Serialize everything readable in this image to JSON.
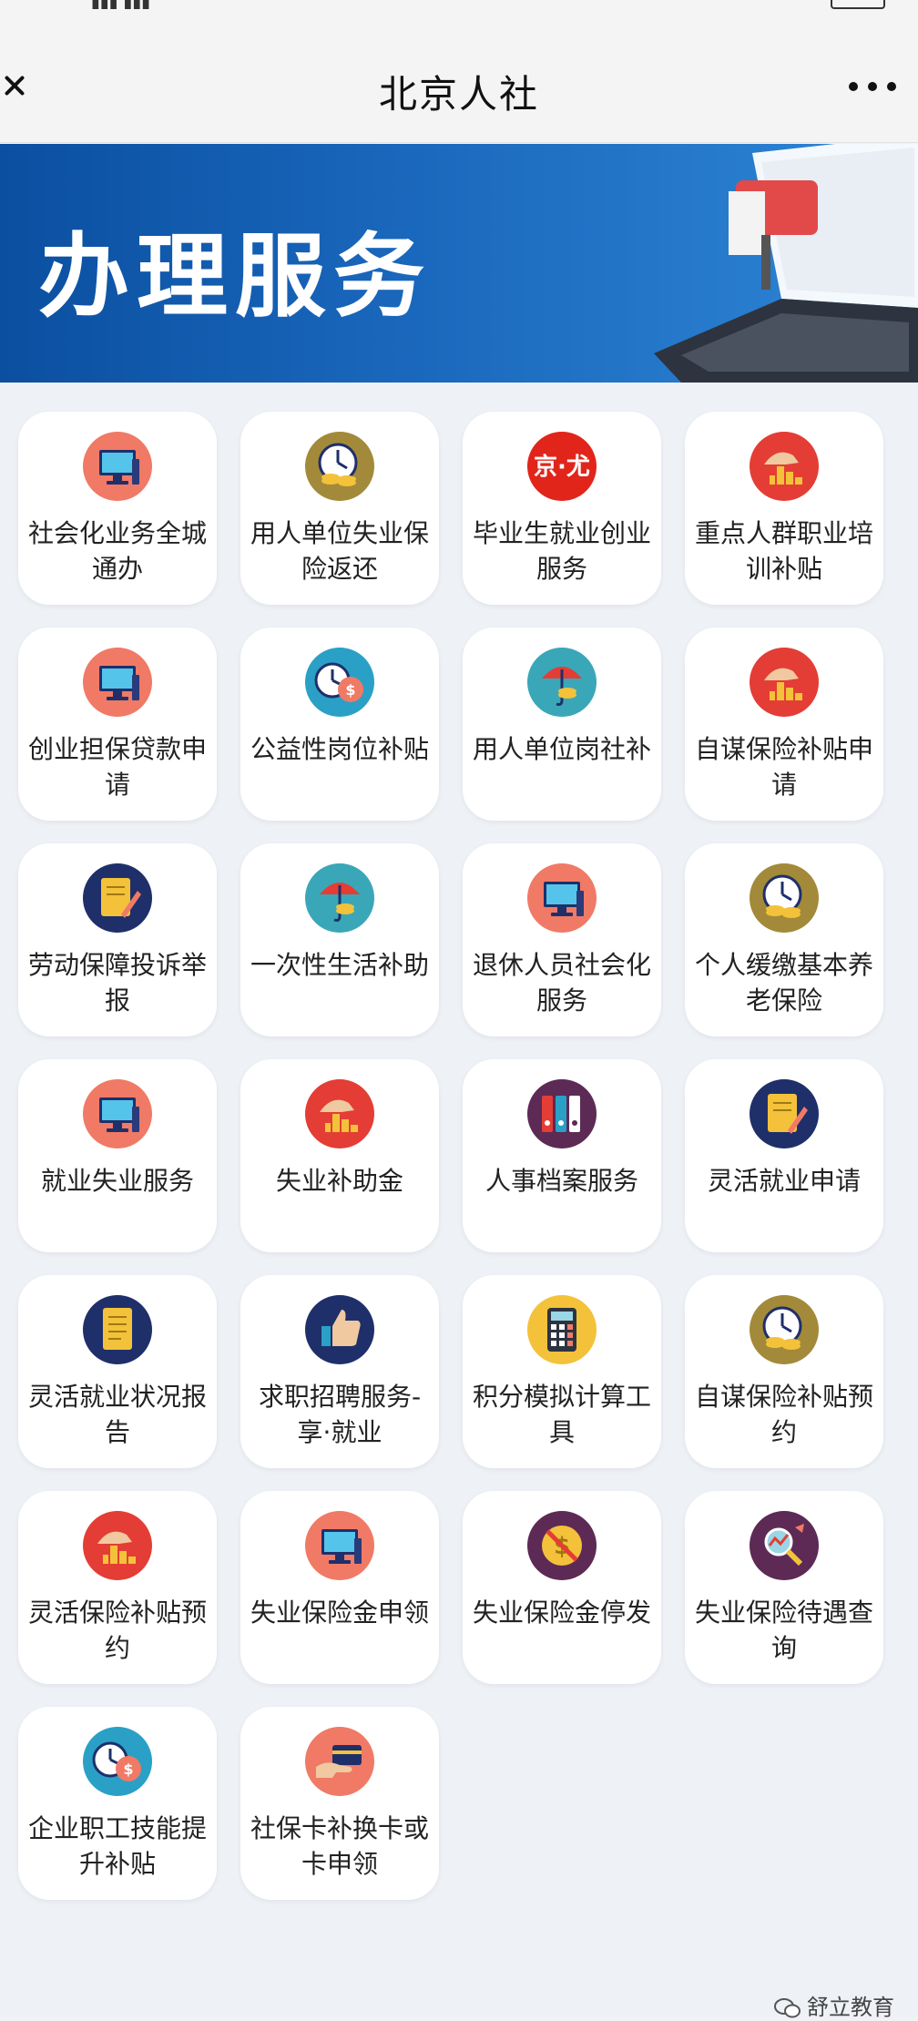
{
  "nav": {
    "title": "北京人社"
  },
  "banner": {
    "title": "办理服务"
  },
  "services": [
    {
      "label": "社会化业务全城通办",
      "icon": "computer-icon"
    },
    {
      "label": "用人单位失业保险返还",
      "icon": "clock-coins-icon"
    },
    {
      "label": "毕业生就业创业服务",
      "icon": "jd-logo-icon"
    },
    {
      "label": "重点人群职业培训补贴",
      "icon": "hand-chart-icon"
    },
    {
      "label": "创业担保贷款申请",
      "icon": "computer-icon"
    },
    {
      "label": "公益性岗位补贴",
      "icon": "clock-money-icon"
    },
    {
      "label": "用人单位岗社补",
      "icon": "umbrella-money-icon"
    },
    {
      "label": "自谋保险补贴申请",
      "icon": "hand-chart-icon"
    },
    {
      "label": "劳动保障投诉举报",
      "icon": "document-pen-icon"
    },
    {
      "label": "一次性生活补助",
      "icon": "umbrella-money-icon"
    },
    {
      "label": "退休人员社会化服务",
      "icon": "computer-icon"
    },
    {
      "label": "个人缓缴基本养老保险",
      "icon": "clock-coins-icon"
    },
    {
      "label": "就业失业服务",
      "icon": "computer-icon"
    },
    {
      "label": "失业补助金",
      "icon": "hand-chart-icon"
    },
    {
      "label": "人事档案服务",
      "icon": "binders-icon"
    },
    {
      "label": "灵活就业申请",
      "icon": "document-pen-icon"
    },
    {
      "label": "灵活就业状况报告",
      "icon": "document-icon"
    },
    {
      "label": "求职招聘服务-享·就业",
      "icon": "thumbs-up-icon"
    },
    {
      "label": "积分模拟计算工具",
      "icon": "calculator-icon"
    },
    {
      "label": "自谋保险补贴预约",
      "icon": "clock-coins-icon"
    },
    {
      "label": "灵活保险补贴预约",
      "icon": "hand-chart-icon"
    },
    {
      "label": "失业保险金申领",
      "icon": "computer-icon"
    },
    {
      "label": "失业保险金停发",
      "icon": "no-money-icon"
    },
    {
      "label": "失业保险待遇查询",
      "icon": "magnifier-chart-icon"
    },
    {
      "label": "企业职工技能提升补贴",
      "icon": "clock-money-icon"
    },
    {
      "label": "社保卡补换卡或卡申领",
      "icon": "hand-card-icon"
    }
  ],
  "watermark": {
    "text": "舒立教育"
  },
  "colors": {
    "banner_blue": "#1a68bd",
    "coral": "#f07a66",
    "red": "#e43d35",
    "navy": "#1f2f6a",
    "teal": "#3aa7b8",
    "gold": "#f3c23a",
    "olive": "#a38a3a",
    "purple": "#5c2a55"
  }
}
